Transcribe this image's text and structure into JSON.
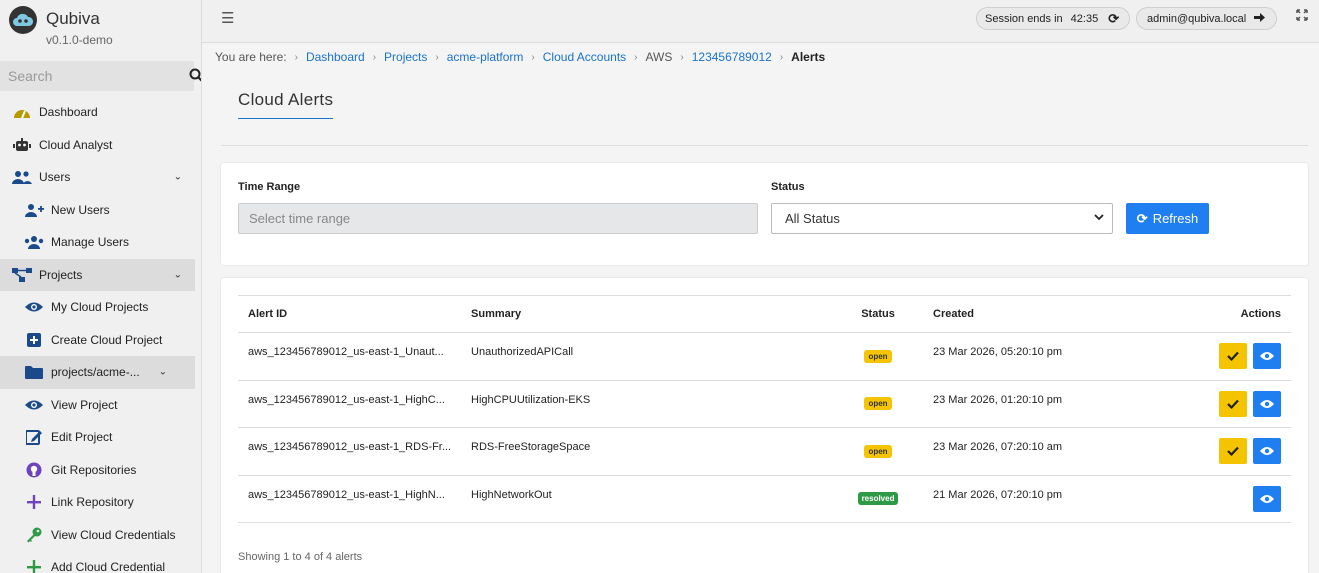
{
  "app": {
    "name": "Qubiva",
    "version": "v0.1.0-demo"
  },
  "sidebar": {
    "search_placeholder": "Search",
    "items": [
      {
        "label": "Dashboard",
        "icon": "dashboard-gauge-icon",
        "color": "#b59a00"
      },
      {
        "label": "Cloud Analyst",
        "icon": "robot-icon",
        "color": "#333333"
      },
      {
        "label": "Users",
        "icon": "users-icon",
        "color": "#1a4a8a",
        "expandable": true
      },
      {
        "label": "New Users",
        "icon": "user-plus-icon",
        "color": "#1a4a8a"
      },
      {
        "label": "Manage Users",
        "icon": "users-cog-icon",
        "color": "#1a4a8a"
      },
      {
        "label": "Projects",
        "icon": "project-diagram-icon",
        "color": "#1a4a8a",
        "expandable": true,
        "active": true
      },
      {
        "label": "My Cloud Projects",
        "icon": "eye-icon",
        "color": "#1a4a8a"
      },
      {
        "label": "Create Cloud Project",
        "icon": "plus-square-icon",
        "color": "#1a4a8a"
      },
      {
        "label": "projects/acme-...",
        "icon": "folder-icon",
        "color": "#1a4a8a",
        "expandable": true,
        "active": true
      },
      {
        "label": "View Project",
        "icon": "eye-icon",
        "color": "#1a4a8a"
      },
      {
        "label": "Edit Project",
        "icon": "edit-icon",
        "color": "#1a4a8a"
      },
      {
        "label": "Git Repositories",
        "icon": "github-icon",
        "color": "#6f42c1"
      },
      {
        "label": "Link Repository",
        "icon": "plus-icon",
        "color": "#6f42c1"
      },
      {
        "label": "View Cloud Credentials",
        "icon": "key-icon",
        "color": "#2f9a45"
      },
      {
        "label": "Add Cloud Credential",
        "icon": "plus-icon",
        "color": "#2f9a45"
      }
    ]
  },
  "topbar": {
    "session_label": "Session ends in",
    "session_time": "42:35",
    "user": "admin@qubiva.local"
  },
  "breadcrumb": {
    "prefix": "You are here:",
    "items": [
      "Dashboard",
      "Projects",
      "acme-platform",
      "Cloud Accounts",
      "AWS",
      "123456789012"
    ],
    "current": "Alerts"
  },
  "page": {
    "title": "Cloud Alerts"
  },
  "filters": {
    "time_range_label": "Time Range",
    "time_range_placeholder": "Select time range",
    "status_label": "Status",
    "status_value": "All Status",
    "refresh_label": "Refresh"
  },
  "table": {
    "headers": [
      "Alert ID",
      "Summary",
      "Status",
      "Created",
      "Actions"
    ],
    "rows": [
      {
        "id": "aws_123456789012_us-east-1_Unaut...",
        "summary": "UnauthorizedAPICall",
        "status": "open",
        "created": "23 Mar 2026, 05:20:10 pm"
      },
      {
        "id": "aws_123456789012_us-east-1_HighC...",
        "summary": "HighCPUUtilization-EKS",
        "status": "open",
        "created": "23 Mar 2026, 01:20:10 pm"
      },
      {
        "id": "aws_123456789012_us-east-1_RDS-Fr...",
        "summary": "RDS-FreeStorageSpace",
        "status": "open",
        "created": "23 Mar 2026, 07:20:10 am"
      },
      {
        "id": "aws_123456789012_us-east-1_HighN...",
        "summary": "HighNetworkOut",
        "status": "resolved",
        "created": "21 Mar 2026, 07:20:10 pm"
      }
    ],
    "footer": "Showing 1 to 4 of 4 alerts"
  }
}
